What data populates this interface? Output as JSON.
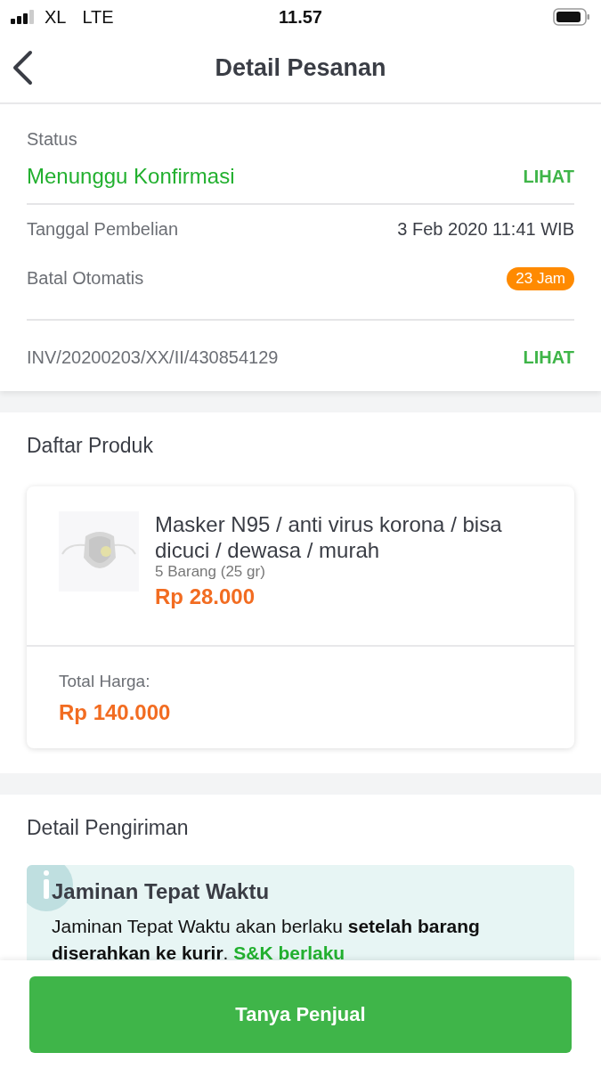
{
  "status_bar": {
    "carrier": "XL",
    "network": "LTE",
    "time": "11.57"
  },
  "header": {
    "title": "Detail Pesanan"
  },
  "order": {
    "status_label": "Status",
    "status": "Menunggu Konfirmasi",
    "status_link": "LIHAT",
    "rows": [
      {
        "kind": "text",
        "label": "Tanggal Pembelian",
        "value": "3 Feb 2020 11:41 WIB"
      },
      {
        "kind": "badge",
        "label": "Batal Otomatis",
        "value": "23 Jam",
        "color": "#ff8a00"
      }
    ],
    "invoice": "INV/20200203/XX/II/430854129",
    "invoice_link": "LIHAT"
  },
  "products": {
    "title": "Daftar Produk",
    "items": [
      {
        "name": "Masker N95 / anti virus korona / bisa dicuci / dewasa / murah",
        "quantity": "5 Barang (25 gr)",
        "price": "Rp 28.000"
      }
    ],
    "total_label": "Total Harga:",
    "total": "Rp 140.000"
  },
  "shipping": {
    "title": "Detail Pengiriman",
    "notice": {
      "title": "Jaminan Tepat Waktu",
      "text": "Jaminan Tepat Waktu akan berlaku **setelah barang diserahkan ke kurir**.",
      "link": "S&K berlaku"
    }
  },
  "action": {
    "label": "Tanya Penjual"
  }
}
